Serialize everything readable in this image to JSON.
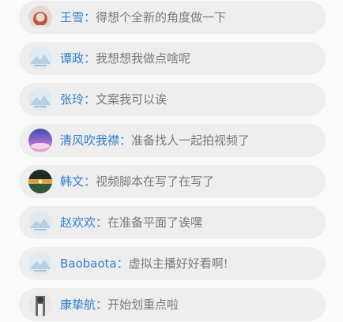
{
  "comments": [
    {
      "name": "王雪",
      "separator": "：",
      "message": "得想个全新的角度做一下",
      "avatar": "photo-girl-red-hair"
    },
    {
      "name": "谭政",
      "separator": "：",
      "message": "我想想我做点啥呢",
      "avatar": "default-mountain-avatar"
    },
    {
      "name": "张玲",
      "separator": "：",
      "message": "文案我可以诶",
      "avatar": "default-mountain-avatar"
    },
    {
      "name": "清风吹我襟",
      "separator": "：",
      "message": "准备找人一起拍视频了",
      "avatar": "photo-purple-sky"
    },
    {
      "name": "韩文",
      "separator": "：",
      "message": "视频脚本在写了在写了",
      "avatar": "photo-sunset-landscape"
    },
    {
      "name": "赵欢欢",
      "separator": "：",
      "message": "在准备平面了诶嘿",
      "avatar": "default-mountain-avatar"
    },
    {
      "name": "Baobaota",
      "separator": "：",
      "message": "虚拟主播好好看啊!",
      "avatar": "default-mountain-avatar"
    },
    {
      "name": "康挚航",
      "separator": "：",
      "message": "开始划重点啦",
      "avatar": "photo-person-grey"
    }
  ],
  "colors": {
    "name": "#2f7fd1",
    "message": "#7a7a7a",
    "bubble": "#eeeeee"
  }
}
